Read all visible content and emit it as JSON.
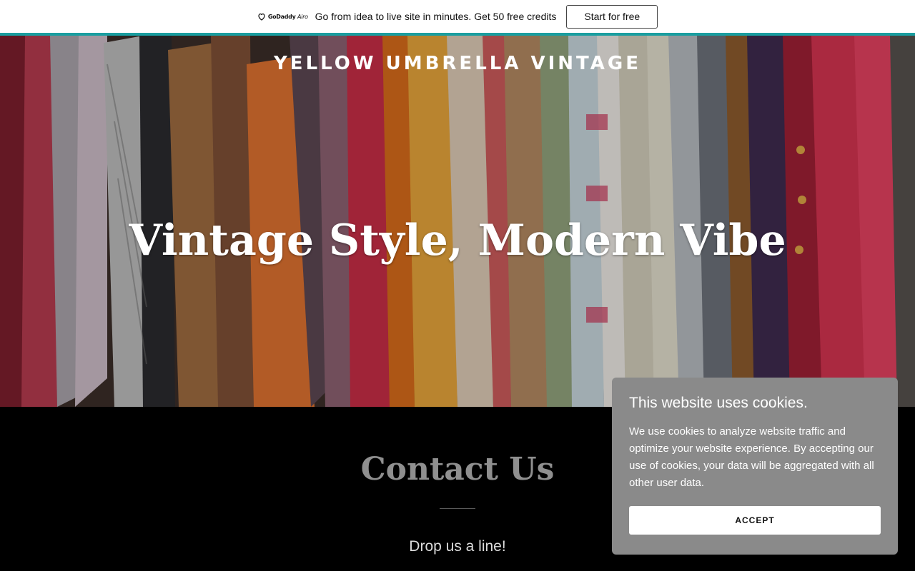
{
  "promo": {
    "logo_text": "GoDaddy",
    "logo_suffix": "Airo",
    "message": "Go from idea to live site in minutes. Get 50 free credits",
    "cta_label": "Start for free",
    "accent_color": "#1a9ea0"
  },
  "hero": {
    "site_title": "YELLOW UMBRELLA VINTAGE",
    "tagline": "Vintage Style, Modern Vibe",
    "background_icon": "clothing-rack-photo"
  },
  "contact": {
    "title": "Contact Us",
    "subtitle": "Drop us a line!"
  },
  "cookie_banner": {
    "title": "This website uses cookies.",
    "body": "We use cookies to analyze website traffic and optimize your website experience. By accepting our use of cookies, your data will be aggregated with all other user data.",
    "accept_label": "ACCEPT"
  }
}
